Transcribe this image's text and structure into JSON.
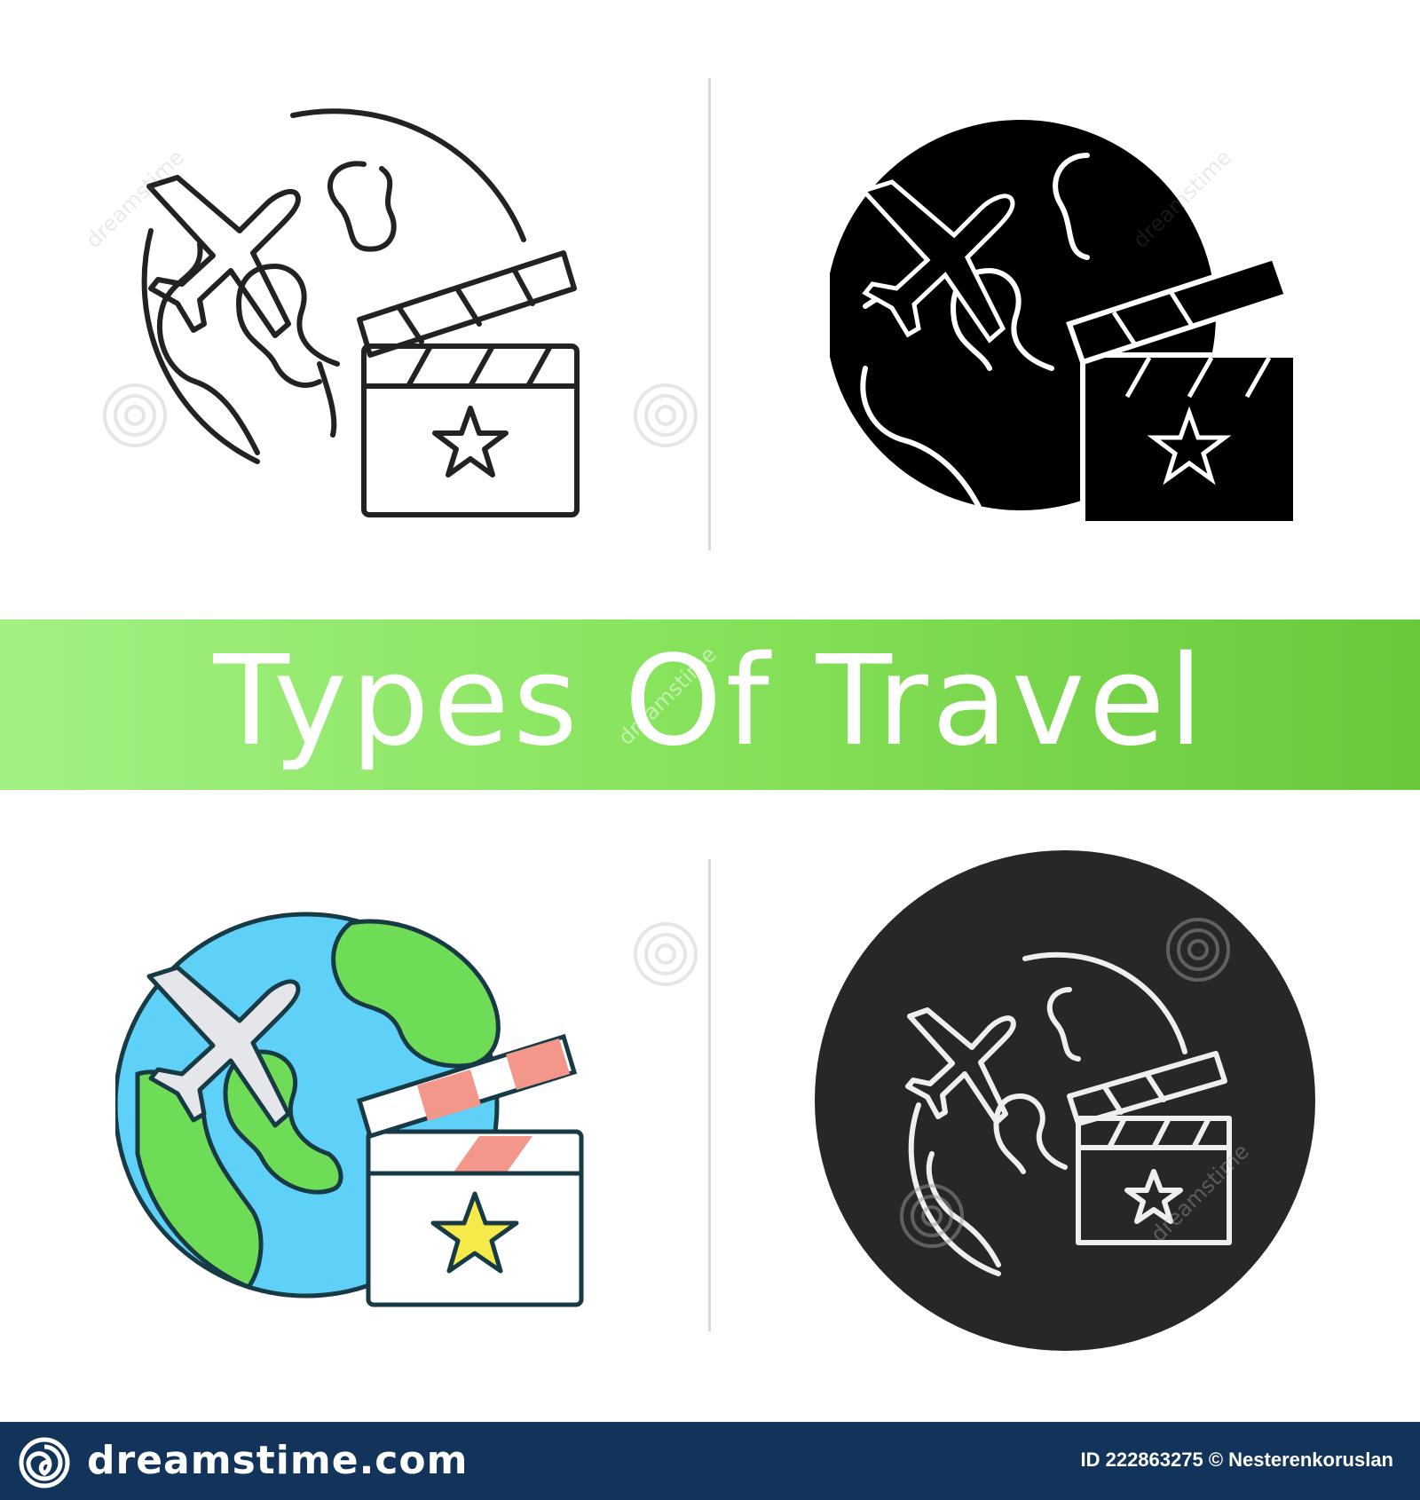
{
  "banner": {
    "title": "Types Of Travel"
  },
  "footer": {
    "brand": "dreamstime.com",
    "image_id": "ID 222863275 © Nesterenkoruslan"
  },
  "watermark": {
    "text": "dreamstime"
  },
  "colors": {
    "banner_green": "#7ddc4e",
    "footer_navy": "#12335a",
    "ocean_blue": "#5fd0f7",
    "land_green": "#6fdc57",
    "clapper_stripe": "#f3978a",
    "star_yellow": "#f5ea4a",
    "chalk_bg": "#272727"
  },
  "icons": [
    {
      "style": "linear",
      "name": "globe-plane-clapperboard-icon"
    },
    {
      "style": "glyph",
      "name": "globe-plane-clapperboard-icon"
    },
    {
      "style": "color",
      "name": "globe-plane-clapperboard-icon"
    },
    {
      "style": "chalk",
      "name": "globe-plane-clapperboard-icon"
    }
  ]
}
